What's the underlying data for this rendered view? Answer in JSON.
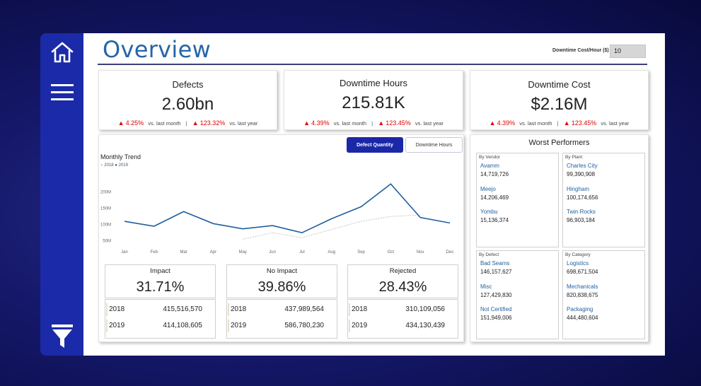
{
  "title": "Overview",
  "param": {
    "label": "Downtime Cost/Hour ($)",
    "value": "10"
  },
  "kpis": [
    {
      "title": "Defects",
      "value": "2.60bn",
      "mom": "4.25%",
      "mom_label": "vs. last month",
      "yoy": "123.32%",
      "yoy_label": "vs. last year"
    },
    {
      "title": "Downtime Hours",
      "value": "215.81K",
      "mom": "4.39%",
      "mom_label": "vs. last month",
      "yoy": "123.45%",
      "yoy_label": "vs. last year"
    },
    {
      "title": "Downtime Cost",
      "value": "$2.16M",
      "mom": "4.39%",
      "mom_label": "vs. last month",
      "yoy": "123.45%",
      "yoy_label": "vs. last year"
    }
  ],
  "toggle": {
    "active": "Defect Quantity",
    "inactive": "Downtime Hours"
  },
  "chart_data": {
    "type": "line",
    "title": "Monthly Trend",
    "categories": [
      "Jan",
      "Feb",
      "Mar",
      "Apr",
      "May",
      "Jun",
      "Jul",
      "Aug",
      "Sep",
      "Oct",
      "Nov",
      "Dec"
    ],
    "series": [
      {
        "name": "2018",
        "values": [
          null,
          null,
          null,
          null,
          55,
          75,
          60,
          85,
          110,
          125,
          130,
          null
        ],
        "color": "#c8c8c8"
      },
      {
        "name": "2019",
        "values": [
          110,
          95,
          140,
          103,
          87,
          97,
          75,
          118,
          155,
          225,
          122,
          105
        ],
        "color": "#1f5f9e"
      }
    ],
    "yticks": [
      "50M",
      "100M",
      "150M",
      "200M"
    ],
    "ylim": [
      45,
      245
    ],
    "grid": false,
    "legend": "top-left"
  },
  "metrics": [
    {
      "title": "Impact",
      "value": "31.71%",
      "rows": [
        {
          "year": "2018",
          "value": "415,516,570"
        },
        {
          "year": "2019",
          "value": "414,108,605"
        }
      ]
    },
    {
      "title": "No Impact",
      "value": "39.86%",
      "rows": [
        {
          "year": "2018",
          "value": "437,989,564"
        },
        {
          "year": "2019",
          "value": "586,780,230"
        }
      ]
    },
    {
      "title": "Rejected",
      "value": "28.43%",
      "rows": [
        {
          "year": "2018",
          "value": "310,109,056"
        },
        {
          "year": "2019",
          "value": "434,130,439"
        }
      ]
    }
  ],
  "worst": {
    "title": "Worst Performers",
    "groups": [
      {
        "head": "By Vendor",
        "items": [
          {
            "name": "Avamm",
            "value": "14,719,726"
          },
          {
            "name": "Meejo",
            "value": "14,206,469"
          },
          {
            "name": "Yombu",
            "value": "15,136,374"
          }
        ]
      },
      {
        "head": "By Plant",
        "items": [
          {
            "name": "Charles City",
            "value": "99,390,908"
          },
          {
            "name": "Hingham",
            "value": "100,174,656"
          },
          {
            "name": "Twin Rocks",
            "value": "96,903,184"
          }
        ]
      },
      {
        "head": "By Defect",
        "items": [
          {
            "name": "Bad Seams",
            "value": "146,157,627"
          },
          {
            "name": "Misc",
            "value": "127,429,830"
          },
          {
            "name": "Not Certified",
            "value": "151,949,006"
          }
        ]
      },
      {
        "head": "By Category",
        "items": [
          {
            "name": "Logistics",
            "value": "698,671,504"
          },
          {
            "name": "Mechanicals",
            "value": "820,838,675"
          },
          {
            "name": "Packaging",
            "value": "444,480,604"
          }
        ]
      }
    ]
  },
  "icons": [
    "home-icon",
    "menu-icon",
    "filter-icon"
  ]
}
